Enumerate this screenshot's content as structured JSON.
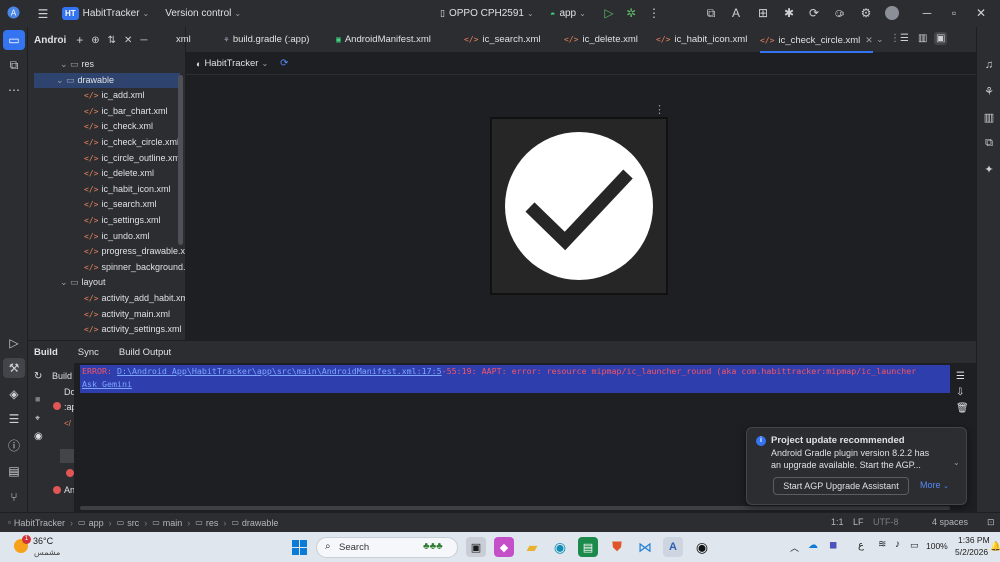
{
  "titlebar": {
    "project_badge": "HT",
    "project_name": "HabitTracker",
    "version_control": "Version control",
    "device": "OPPO CPH2591",
    "run_config": "app"
  },
  "project_panel": {
    "title": "Androi",
    "tree": [
      {
        "label": "res",
        "kind": "folder",
        "indent": 0
      },
      {
        "label": "drawable",
        "kind": "folder",
        "indent": 1,
        "selected": true
      },
      {
        "label": "ic_add.xml",
        "kind": "xml"
      },
      {
        "label": "ic_bar_chart.xml",
        "kind": "xml"
      },
      {
        "label": "ic_check.xml",
        "kind": "xml"
      },
      {
        "label": "ic_check_circle.xml",
        "kind": "xml"
      },
      {
        "label": "ic_circle_outline.xml",
        "kind": "xml"
      },
      {
        "label": "ic_delete.xml",
        "kind": "xml"
      },
      {
        "label": "ic_habit_icon.xml",
        "kind": "xml"
      },
      {
        "label": "ic_search.xml",
        "kind": "xml"
      },
      {
        "label": "ic_settings.xml",
        "kind": "xml"
      },
      {
        "label": "ic_undo.xml",
        "kind": "xml"
      },
      {
        "label": "progress_drawable.xr",
        "kind": "xml"
      },
      {
        "label": "spinner_background.:",
        "kind": "xml"
      },
      {
        "label": "layout",
        "kind": "folder",
        "indent": 0
      },
      {
        "label": "activity_add_habit.xm",
        "kind": "xml"
      },
      {
        "label": "activity_main.xml",
        "kind": "xml"
      },
      {
        "label": "activity_settings.xml",
        "kind": "xml"
      }
    ]
  },
  "tabs": [
    {
      "label": "xml",
      "icon": "xml-icon"
    },
    {
      "label": "build.gradle (:app)",
      "icon": "gradle-icon"
    },
    {
      "label": "AndroidManifest.xml",
      "icon": "manifest-icon"
    },
    {
      "label": "ic_search.xml",
      "icon": "xml-icon"
    },
    {
      "label": "ic_delete.xml",
      "icon": "xml-icon"
    },
    {
      "label": "ic_habit_icon.xml",
      "icon": "xml-icon"
    },
    {
      "label": "ic_check_circle.xml",
      "icon": "xml-icon",
      "active": true
    }
  ],
  "editor": {
    "theme_selector": "HabitTracker"
  },
  "build_panel": {
    "tabs": [
      "Build",
      "Sync",
      "Build Output"
    ],
    "tree_items": [
      "Build",
      "Do",
      ":ap",
      "",
      "",
      "An"
    ],
    "error_prefix": "ERROR: ",
    "error_path": "D:\\Android App\\HabitTracker\\app\\src\\main\\AndroidManifest.xml:17:5",
    "error_message": "-55:19: AAPT: error: resource mipmap/ic_launcher_round (aka com.habittracker:mipmap/ic_launcher",
    "ask_gemini": "Ask Gemini"
  },
  "notification": {
    "title": "Project update recommended",
    "body_line1": "Android Gradle plugin version 8.2.2 has",
    "body_line2": "an upgrade available. Start the AGP...",
    "primary_button": "Start AGP Upgrade Assistant",
    "more": "More"
  },
  "statusbar": {
    "breadcrumb": [
      "HabitTracker",
      "app",
      "src",
      "main",
      "res",
      "drawable"
    ],
    "position": "1:1",
    "line_ending": "LF",
    "encoding": "UTF-8",
    "indent": "4 spaces"
  },
  "taskbar": {
    "weather_temp": "36°C",
    "weather_desc": "مشمس",
    "weather_badge": "1",
    "search_label": "Search",
    "lang": "ع",
    "battery": "100%",
    "time": "1:36 PM",
    "date": "5/2/2026"
  },
  "colors": {
    "accent": "#3574f0",
    "error": "#f75464",
    "selection": "#2e436e",
    "error_highlight": "#2e3fad"
  }
}
